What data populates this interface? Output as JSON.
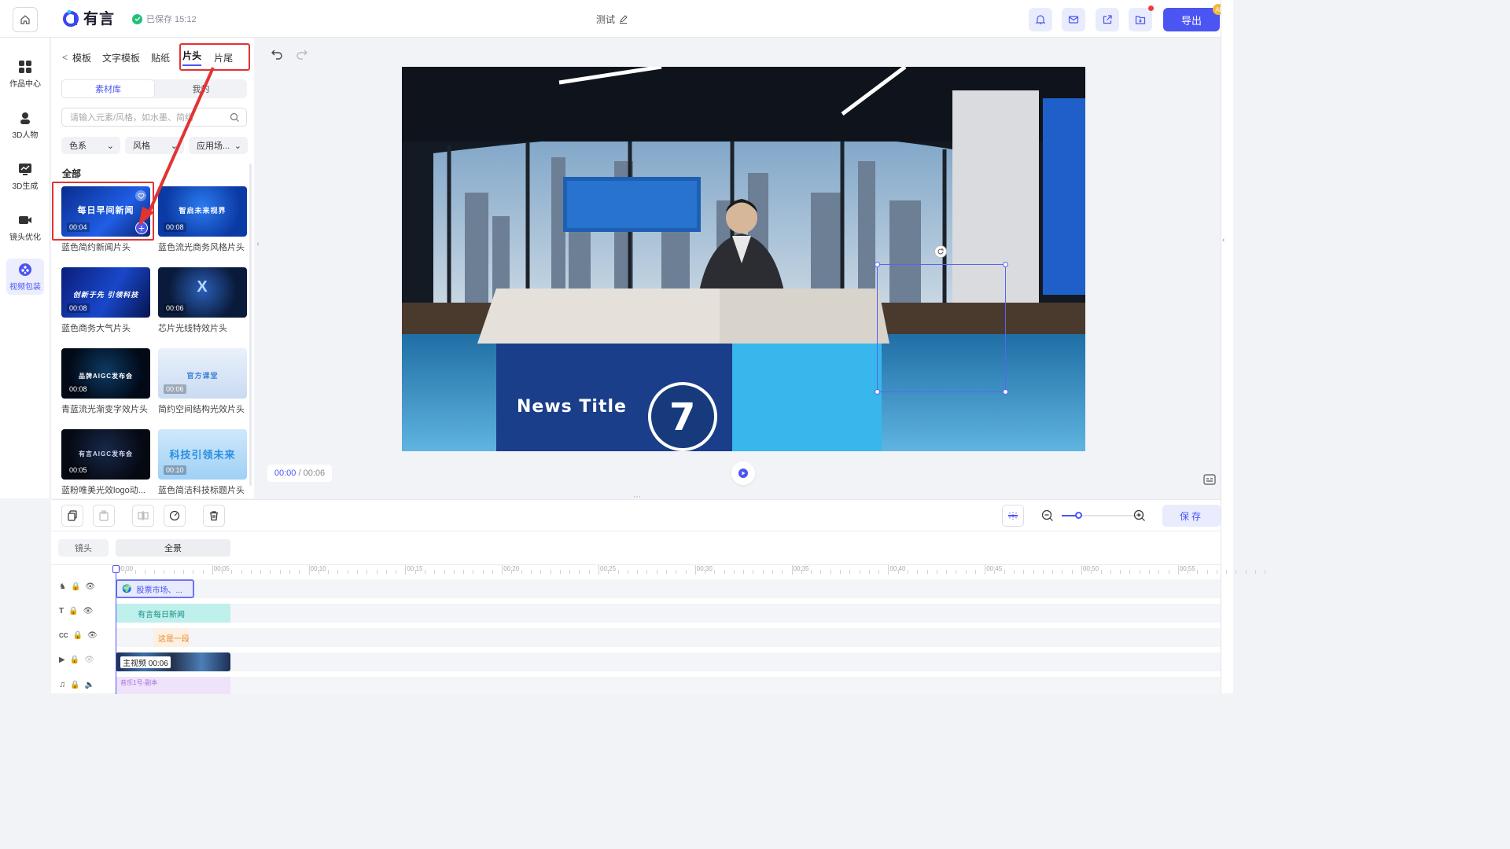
{
  "header": {
    "brand": "有言",
    "save_status": "已保存 15:12",
    "doc_title": "测试",
    "export_label": "导出",
    "ai_badge": "AI"
  },
  "leftnav": {
    "items": [
      {
        "label": "作品中心",
        "icon": "grid-icon"
      },
      {
        "label": "3D人物",
        "icon": "person-icon"
      },
      {
        "label": "3D生成",
        "icon": "chart-icon"
      },
      {
        "label": "镜头优化",
        "icon": "camera-icon"
      },
      {
        "label": "视频包装",
        "icon": "package-icon",
        "active": true
      }
    ]
  },
  "panel": {
    "tabs": [
      "模板",
      "文字模板",
      "贴纸",
      "片头",
      "片尾"
    ],
    "active_tab": "片头",
    "segments": [
      "素材库",
      "我的"
    ],
    "search_placeholder": "请输入元素/风格，如水墨、简约",
    "filters": [
      "色系",
      "风格",
      "应用场..."
    ],
    "section_label": "全部",
    "cards": [
      {
        "name": "蓝色简约新闻片头",
        "duration": "00:04",
        "thumb_text": "每日早间新闻"
      },
      {
        "name": "蓝色流光商务风格片头",
        "duration": "00:08",
        "thumb_text": "智启未来视界"
      },
      {
        "name": "蓝色商务大气片头",
        "duration": "00:08",
        "thumb_text": "创新于先 引领科技"
      },
      {
        "name": "芯片光线特效片头",
        "duration": "00:06",
        "thumb_text": "X"
      },
      {
        "name": "青蓝流光渐变字效片头",
        "duration": "00:08",
        "thumb_text": "品牌AIGC发布会"
      },
      {
        "name": "简约空间结构光效片头",
        "duration": "00:06",
        "thumb_text": "官方课堂"
      },
      {
        "name": "蓝粉唯美光效logo动...",
        "duration": "00:05",
        "thumb_text": "有言AIGC发布会"
      },
      {
        "name": "蓝色简洁科技标题片头",
        "duration": "00:10",
        "thumb_text": "科技引领未来"
      }
    ]
  },
  "preview": {
    "desk_title": "News Title",
    "desk_number": "7",
    "current_time": "00:00",
    "total_time": "/ 00:06"
  },
  "timeline": {
    "save_label": "保存",
    "shot_label": "镜头",
    "shot_item": "全景",
    "ruler_labels": [
      "00:00",
      "00:05",
      "00:10",
      "00:15",
      "00:20",
      "00:25",
      "00:30",
      "00:35",
      "00:40",
      "00:45",
      "00:50",
      "00:55"
    ],
    "tracks": [
      {
        "clip": "股票市场、..."
      },
      {
        "clip": "有言每日新闻"
      },
      {
        "clip": "这是一段"
      },
      {
        "clip": "主视频 00:06"
      },
      {
        "clip": "音乐1号-副本"
      }
    ],
    "zoom_level": 0.2
  },
  "colors": {
    "accent": "#4b55f2",
    "annotation_red": "#e23333",
    "saved_green": "#20c07a"
  }
}
